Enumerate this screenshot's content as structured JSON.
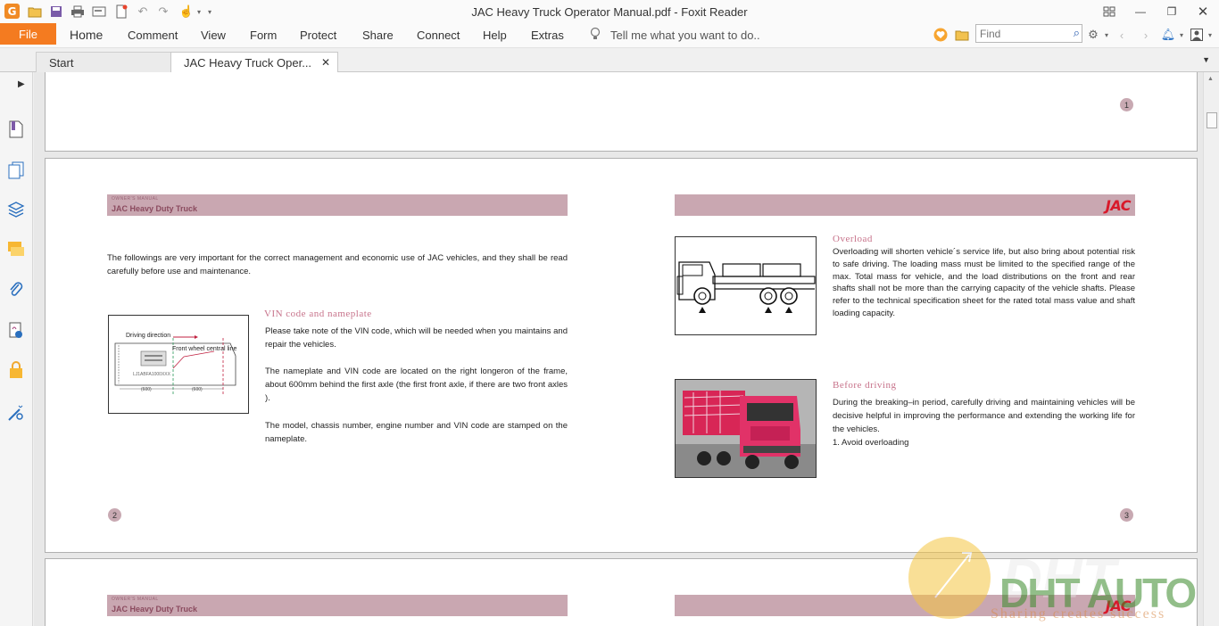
{
  "window": {
    "title": "JAC Heavy Truck Operator Manual.pdf - Foxit Reader"
  },
  "ribbon": {
    "file_label": "File",
    "tabs": [
      "Home",
      "Comment",
      "View",
      "Form",
      "Protect",
      "Share",
      "Connect",
      "Help",
      "Extras"
    ],
    "tell_me": "Tell me what you want to do..",
    "find_placeholder": "Find"
  },
  "doc_tabs": {
    "start": "Start",
    "active": "JAC Heavy Truck Oper..."
  },
  "document": {
    "page1_number": "1",
    "page2": {
      "number": "2",
      "header_small": "OWNER'S MANUAL",
      "header_title": "JAC Heavy Duty Truck",
      "intro": "The followings are very important for the correct management and economic use of JAC vehicles, and they shall be read carefully before use and maintenance.",
      "vin_heading": "VIN code and nameplate",
      "vin_p1": "Please take note of the VIN code, which will be needed when you maintains and repair the vehicles.",
      "vin_p2": "The nameplate and VIN code are located on the right longeron of the frame, about 600mm behind the first axle (the first front axle, if there are two front axles ).",
      "vin_p3": "The model, chassis number, engine number and VIN code are stamped on the nameplate.",
      "diagram_driving_direction": "Driving direction",
      "diagram_front_wheel": "Front wheel central line",
      "diagram_dim1": "(600)",
      "diagram_dim2": "(600)"
    },
    "page3": {
      "number": "3",
      "logo": "JAC",
      "overload_heading": "Overload",
      "overload_text": "Overloading will shorten vehicle´s service life, but also bring about potential risk to safe driving. The loading mass must be limited to the specified range of the max. Total mass for vehicle, and the load distributions on the front and rear shafts shall not be more than the carrying capacity of the vehicle shafts. Please refer to the technical specification sheet for the rated total mass value and shaft loading capacity.",
      "before_heading": "Before driving",
      "before_text": "During the breaking–in period, carefully driving and maintaining vehicles will be decisive helpful in improving the performance and extending the working life for the vehicles.",
      "before_item": "1. Avoid overloading"
    },
    "page4": {
      "header_small": "OWNER'S MANUAL",
      "header_title": "JAC Heavy Duty Truck",
      "logo": "JAC"
    }
  },
  "watermark": {
    "text": "Sharing creates success",
    "brand": "DHT AUTO"
  },
  "colors": {
    "file_tab": "#f47b20",
    "header_band": "#c9a7b1",
    "jac_red": "#d8192a",
    "section_heading": "#c7728a"
  }
}
